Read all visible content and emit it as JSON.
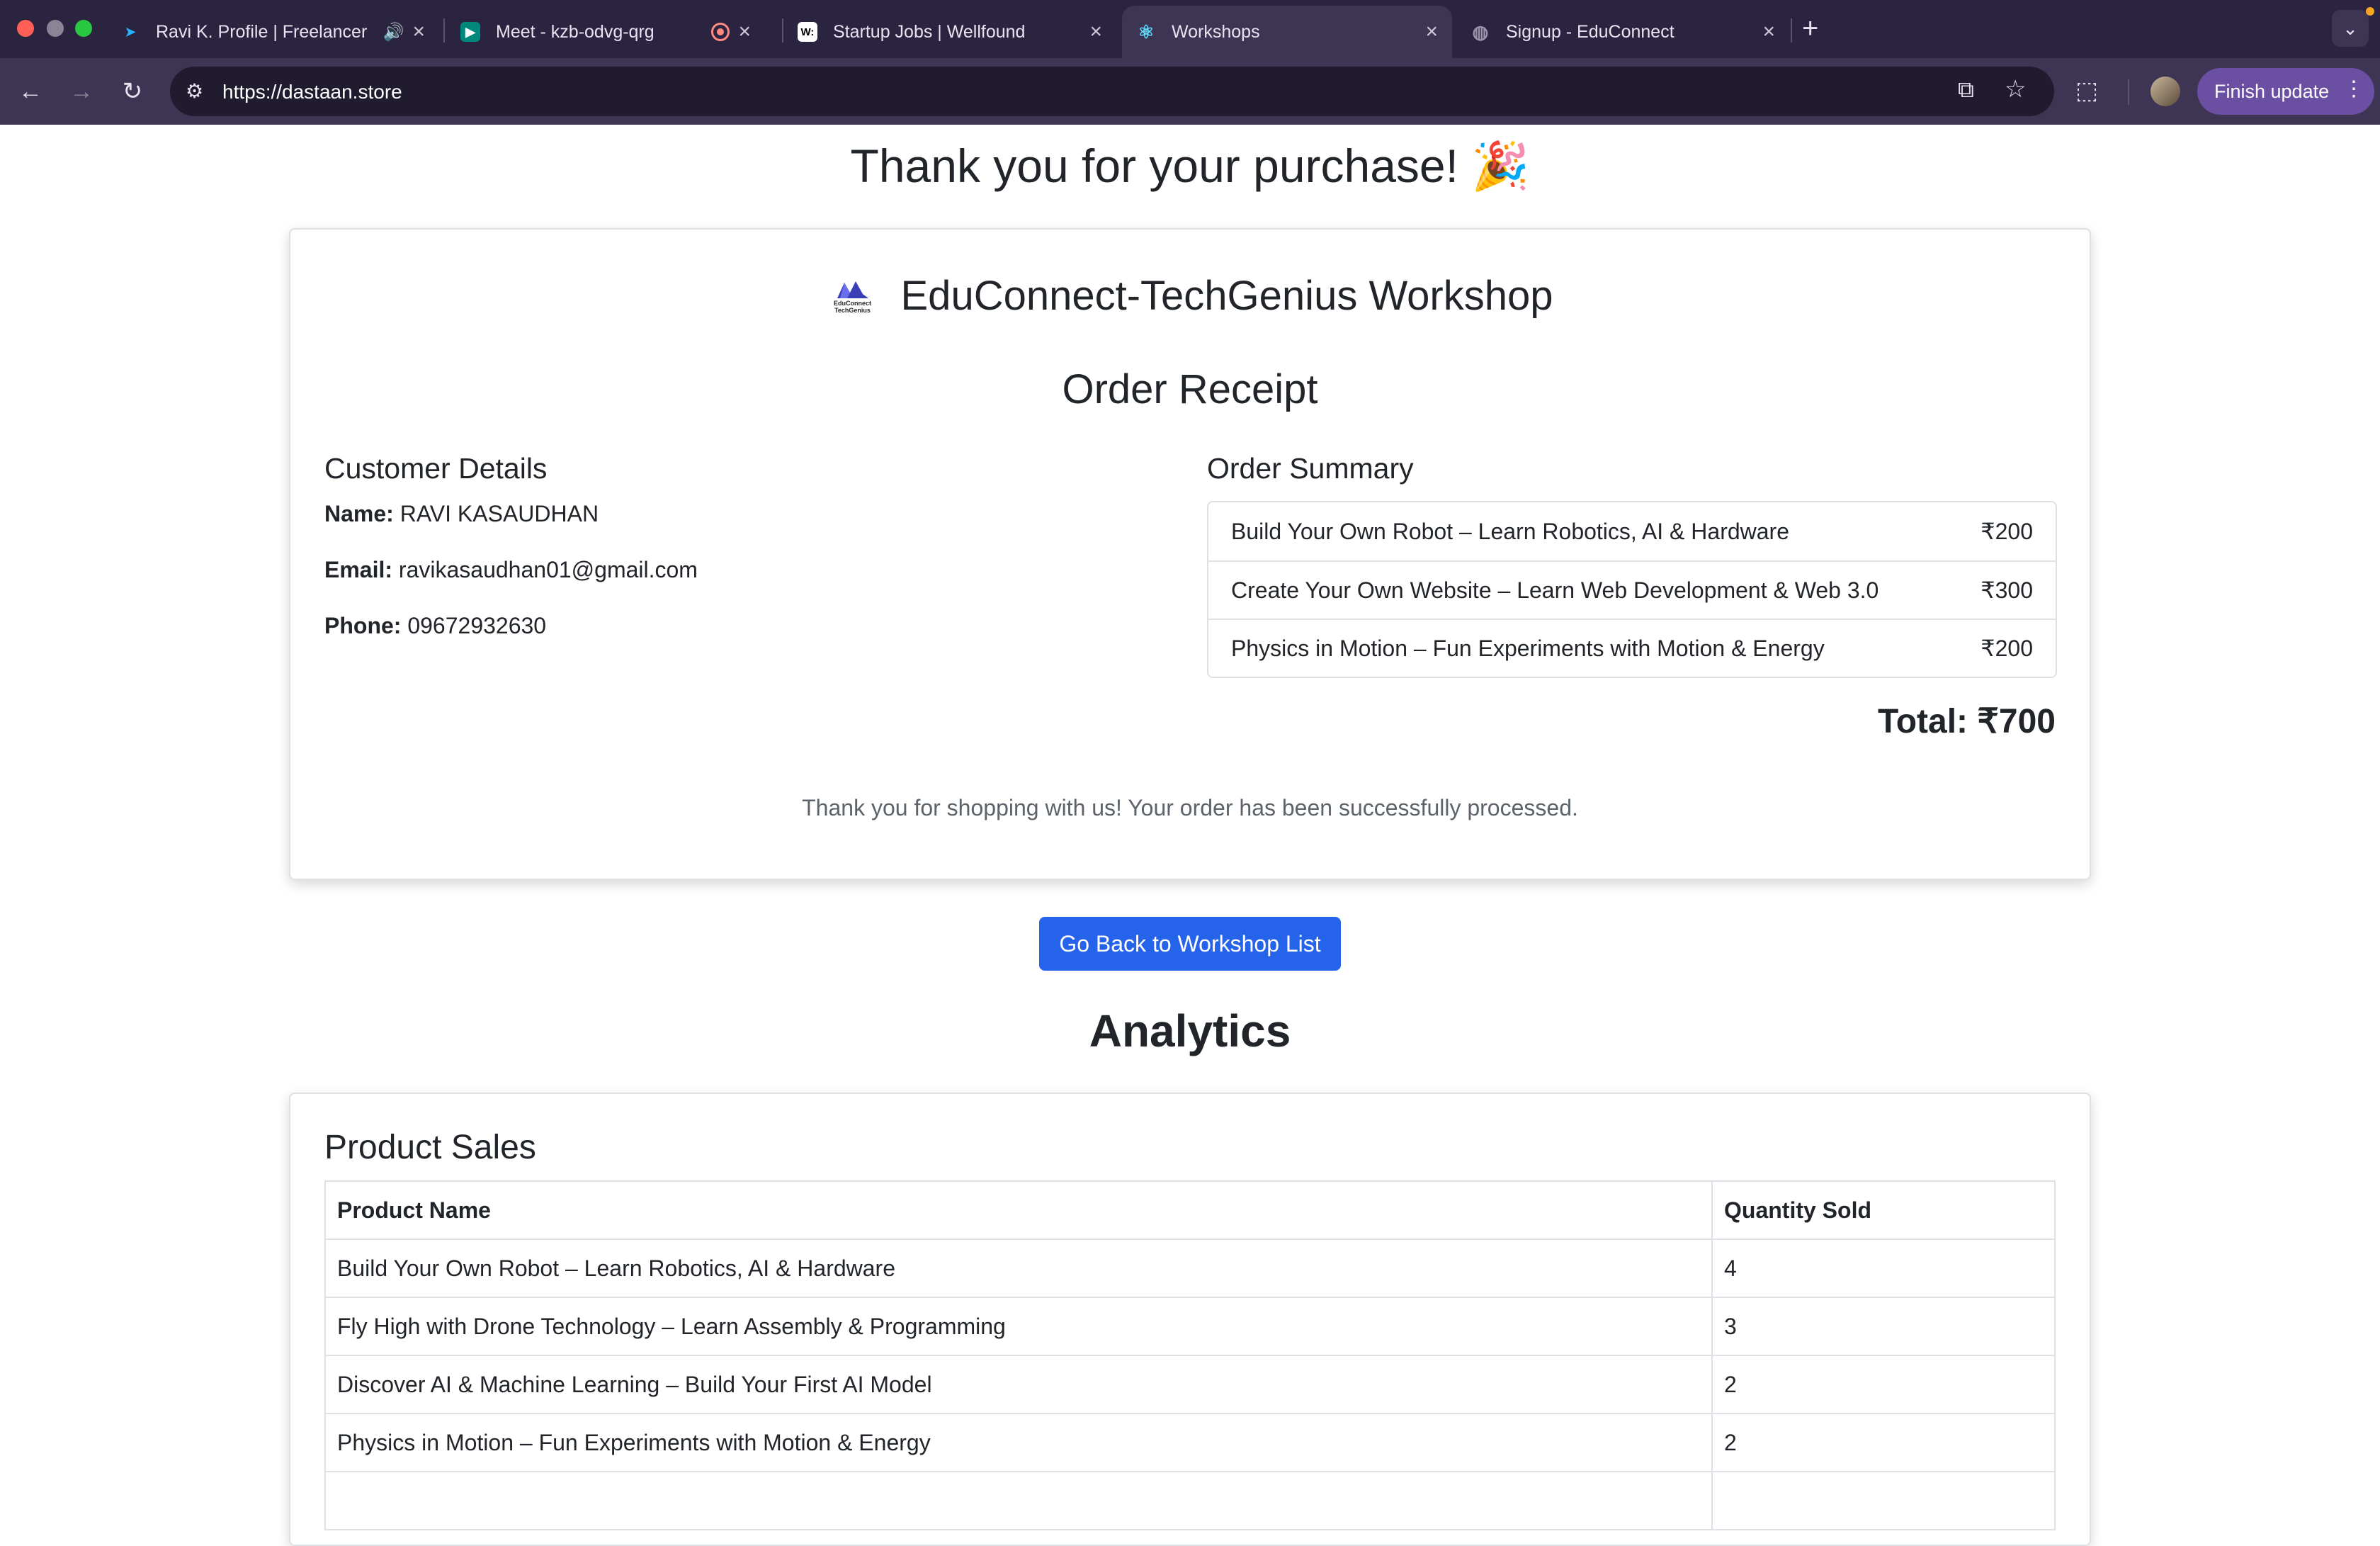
{
  "browser": {
    "tabs": [
      {
        "title": "Ravi K. Profile | Freelancer",
        "active": false,
        "favicon": "freelancer-bird-icon",
        "audio": true
      },
      {
        "title": "Meet - kzb-odvg-qrg",
        "active": false,
        "favicon": "google-meet-icon",
        "recording": true
      },
      {
        "title": "Startup Jobs | Wellfound",
        "active": false,
        "favicon": "wellfound-icon"
      },
      {
        "title": "Workshops",
        "active": true,
        "favicon": "react-icon"
      },
      {
        "title": "Signup - EduConnect",
        "active": false,
        "favicon": "globe-icon"
      }
    ],
    "url": "https://dastaan.store",
    "finish_update_label": "Finish update",
    "colors": {
      "tabbar": "#2b2440",
      "toolbar": "#3d3553",
      "update_button": "#6a4fa3"
    }
  },
  "page": {
    "heading": "Thank you for your purchase! 🎉",
    "receipt": {
      "brand_name": "EduConnect-TechGenius Workshop",
      "logo_text_line1": "EduConnect",
      "logo_text_line2": "TechGenius",
      "title": "Order Receipt",
      "customer_heading": "Customer Details",
      "customer": {
        "name_label": "Name:",
        "name": "RAVI KASAUDHAN",
        "email_label": "Email:",
        "email": "ravikasaudhan01@gmail.com",
        "phone_label": "Phone:",
        "phone": "09672932630"
      },
      "summary_heading": "Order Summary",
      "items": [
        {
          "name": "Build Your Own Robot – Learn Robotics, AI & Hardware",
          "price": "₹200"
        },
        {
          "name": "Create Your Own Website – Learn Web Development & Web 3.0",
          "price": "₹300"
        },
        {
          "name": "Physics in Motion – Fun Experiments with Motion & Energy",
          "price": "₹200"
        }
      ],
      "total_label": "Total:",
      "total_value": "₹700",
      "footnote": "Thank you for shopping with us! Your order has been successfully processed."
    },
    "back_button_label": "Go Back to Workshop List",
    "analytics_heading": "Analytics",
    "product_sales": {
      "title": "Product Sales",
      "columns": [
        "Product Name",
        "Quantity Sold"
      ],
      "rows": [
        {
          "name": "Build Your Own Robot – Learn Robotics, AI & Hardware",
          "qty": "4"
        },
        {
          "name": "Fly High with Drone Technology – Learn Assembly & Programming",
          "qty": "3"
        },
        {
          "name": "Discover AI & Machine Learning – Build Your First AI Model",
          "qty": "2"
        },
        {
          "name": "Physics in Motion – Fun Experiments with Motion & Energy",
          "qty": "2"
        }
      ]
    },
    "colors": {
      "primary_button": "#2563eb",
      "muted_text": "#5c636a"
    }
  }
}
